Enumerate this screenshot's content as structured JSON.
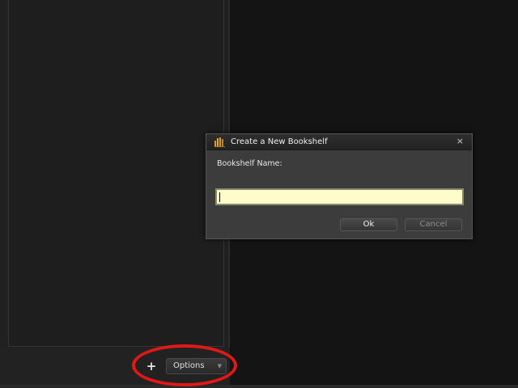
{
  "dialog": {
    "title": "Create a New Bookshelf",
    "icon": "bookshelf-app-icon",
    "close_glyph": "×",
    "field_label": "Bookshelf Name:",
    "name_value": "",
    "ok_label": "Ok",
    "cancel_label": "Cancel"
  },
  "left_panel": {
    "add_label": "+",
    "options_label": "Options"
  },
  "colors": {
    "input_background": "#fefcc8",
    "highlight": "#e01818",
    "app_icon": "#d9a020"
  }
}
